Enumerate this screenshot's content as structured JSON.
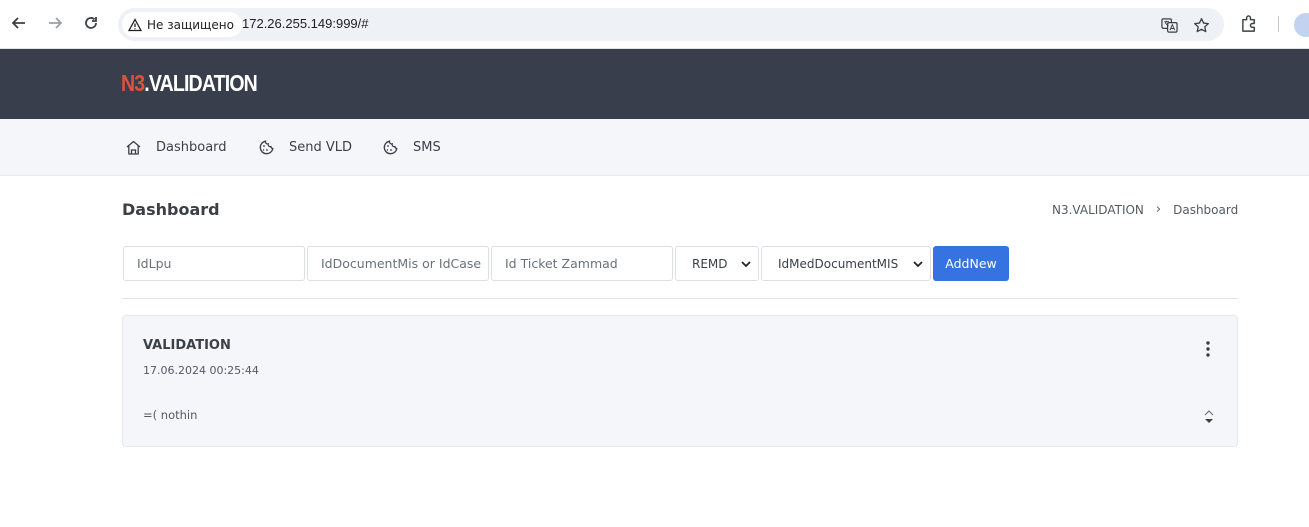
{
  "browser": {
    "security_label": "Не защищено",
    "url": "172.26.255.149:999/#"
  },
  "brand": {
    "part1": "N3",
    "part2": ".VALIDATION"
  },
  "menu": {
    "items": [
      {
        "label": "Dashboard",
        "icon": "home-icon"
      },
      {
        "label": "Send VLD",
        "icon": "cookie-icon"
      },
      {
        "label": "SMS",
        "icon": "cookie-icon"
      }
    ]
  },
  "page": {
    "title": "Dashboard",
    "breadcrumb": [
      "N3.VALIDATION",
      "Dashboard"
    ]
  },
  "form": {
    "idlpu_placeholder": "IdLpu",
    "iddoc_placeholder": "IdDocumentMis or IdCase",
    "ticket_placeholder": "Id Ticket Zammad",
    "type_select_value": "REMD",
    "doc_select_value": "IdMedDocumentMIS",
    "add_label": "AddNew"
  },
  "card": {
    "title": "VALIDATION",
    "timestamp": "17.06.2024 00:25:44",
    "text": "=( nothin"
  },
  "colors": {
    "header_bg": "#383e4b",
    "brand_accent": "#e0503e",
    "primary_button": "#3574e0"
  }
}
